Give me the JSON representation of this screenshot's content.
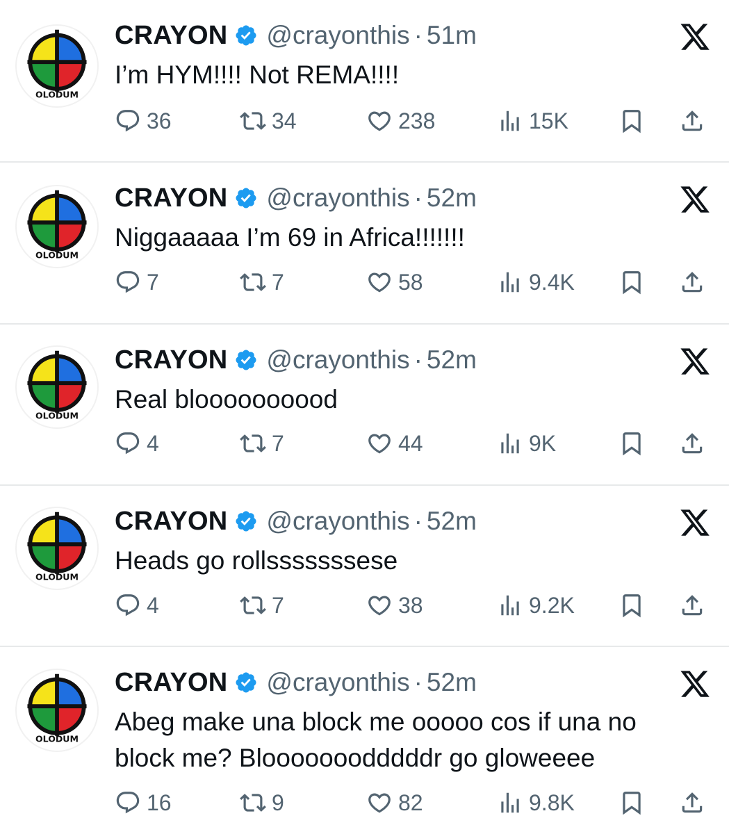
{
  "colors": {
    "text_primary": "#0f1419",
    "text_secondary": "#536471",
    "verified_blue": "#1d9bf0",
    "divider": "#e7e9ea"
  },
  "icons": {
    "reply": "speech-bubble-icon",
    "retweet": "retweet-arrows-icon",
    "like": "heart-icon",
    "views": "bar-chart-icon",
    "bookmark": "bookmark-icon",
    "share": "share-upload-icon",
    "platform": "x-logo-icon",
    "verified": "verified-badge-icon"
  },
  "avatar": {
    "label": "OLODUM",
    "quadrant_colors": [
      "#f5e31a",
      "#1f6fe0",
      "#1e9a3c",
      "#e0242a"
    ]
  },
  "tweets": [
    {
      "name": "CRAYON",
      "handle": "@crayonthis",
      "separator": "·",
      "time": "51m",
      "text": "I’m HYM!!!! Not REMA!!!!",
      "replies": "36",
      "retweets": "34",
      "likes": "238",
      "views": "15K"
    },
    {
      "name": "CRAYON",
      "handle": "@crayonthis",
      "separator": "·",
      "time": "52m",
      "text": "Niggaaaaa I’m 69 in Africa!!!!!!!",
      "replies": "7",
      "retweets": "7",
      "likes": "58",
      "views": "9.4K"
    },
    {
      "name": "CRAYON",
      "handle": "@crayonthis",
      "separator": "·",
      "time": "52m",
      "text": "Real bloooooooood",
      "replies": "4",
      "retweets": "7",
      "likes": "44",
      "views": "9K"
    },
    {
      "name": "CRAYON",
      "handle": "@crayonthis",
      "separator": "·",
      "time": "52m",
      "text": "Heads go rollsssssssese",
      "replies": "4",
      "retweets": "7",
      "likes": "38",
      "views": "9.2K"
    },
    {
      "name": "CRAYON",
      "handle": "@crayonthis",
      "separator": "·",
      "time": "52m",
      "text": "Abeg make una block me ooooo cos if una no block me? Blooooooodddddr go gloweeee",
      "replies": "16",
      "retweets": "9",
      "likes": "82",
      "views": "9.8K"
    }
  ]
}
